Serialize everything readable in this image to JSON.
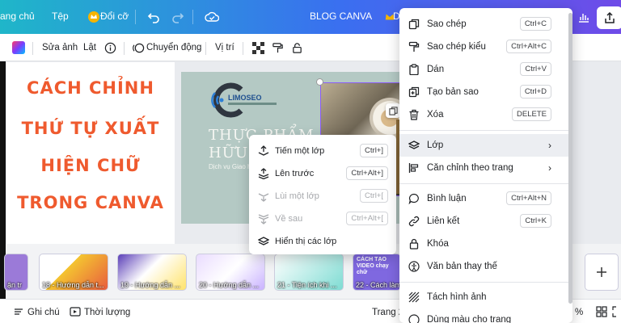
{
  "header": {
    "menu_home": "ang chủ",
    "menu_file": "Tệp",
    "menu_resize": "Đổi cỡ",
    "doc_title": "BLOG CANVA",
    "user_fragment": "D"
  },
  "toolbar": {
    "edit_photo": "Sửa ảnh",
    "flip": "Lật",
    "animate": "Chuyển động",
    "position": "Vị trí"
  },
  "article": {
    "line1": "CÁCH CHỈNH",
    "line2": "THỨ TỰ XUẤT",
    "line3": "HIỆN CHỮ",
    "line4": "TRONG CANVA"
  },
  "slide": {
    "brand": "LIMOSEO",
    "headline1": "THỰC PHẨM",
    "headline2": "HỮU C",
    "subtext": "Dịch vụ Giao hà"
  },
  "thumbnails": [
    {
      "label": "ận tr"
    },
    {
      "label": "18 - Hướng dẫn t..."
    },
    {
      "label": "19 - Hướng dẫn ..."
    },
    {
      "label": "20 - Hướng dẫn ..."
    },
    {
      "label": "21 - Tiện ích khi ..."
    },
    {
      "label": "22 - Cách làm ..."
    }
  ],
  "thumb_small_text": "CÁCH TẠO VIDEO chạy chữ",
  "bottom": {
    "notes": "Ghi chú",
    "duration": "Thời lượng",
    "page": "Trang 2",
    "zoom_fragment": "%"
  },
  "context_menu": {
    "copy": {
      "label": "Sao chép",
      "shortcut": "Ctrl+C"
    },
    "copy_style": {
      "label": "Sao chép kiểu",
      "shortcut": "Ctrl+Alt+C"
    },
    "paste": {
      "label": "Dán",
      "shortcut": "Ctrl+V"
    },
    "duplicate": {
      "label": "Tạo bản sao",
      "shortcut": "Ctrl+D"
    },
    "delete": {
      "label": "Xóa",
      "shortcut": "DELETE"
    },
    "layer": {
      "label": "Lớp"
    },
    "align": {
      "label": "Căn chỉnh theo trang"
    },
    "comment": {
      "label": "Bình luận",
      "shortcut": "Ctrl+Alt+N"
    },
    "link": {
      "label": "Liên kết",
      "shortcut": "Ctrl+K"
    },
    "lock": {
      "label": "Khóa"
    },
    "alt_text": {
      "label": "Văn bản thay thế"
    },
    "separate": {
      "label": "Tách hình ảnh"
    },
    "cutoff": {
      "label": "Dùng màu cho trang"
    }
  },
  "layer_submenu": {
    "forward": {
      "label": "Tiến một lớp",
      "shortcut": "Ctrl+]"
    },
    "to_front": {
      "label": "Lên trước",
      "shortcut": "Ctrl+Alt+]"
    },
    "backward": {
      "label": "Lùi một lớp",
      "shortcut": "Ctrl+["
    },
    "to_back": {
      "label": "Về sau",
      "shortcut": "Ctrl+Alt+["
    },
    "show_layers": {
      "label": "Hiển thị các lớp"
    }
  },
  "colors": {
    "title_orange": "#ef5a2e",
    "selection_purple": "#8b5cf6",
    "header_gradient_start": "#1fb6c9",
    "header_gradient_end": "#6f4be8"
  }
}
